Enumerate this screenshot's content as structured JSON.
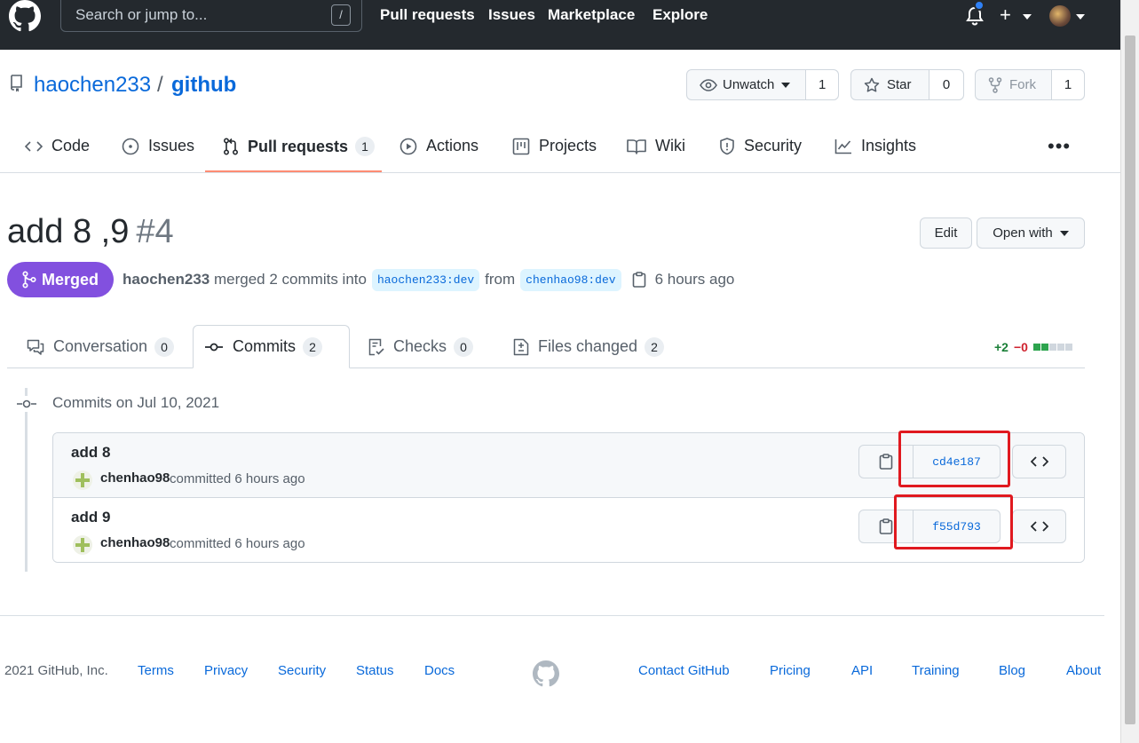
{
  "topbar": {
    "search_placeholder": "Search or jump to...",
    "search_shortcut": "/",
    "nav": [
      "Pull requests",
      "Issues",
      "Marketplace",
      "Explore"
    ],
    "plus": "+"
  },
  "repo": {
    "owner": "haochen233",
    "separator": "/",
    "name": "github",
    "unwatch": {
      "label": "Unwatch",
      "count": "1"
    },
    "star": {
      "label": "Star",
      "count": "0"
    },
    "fork": {
      "label": "Fork",
      "count": "1"
    }
  },
  "repo_nav": {
    "code": "Code",
    "issues": "Issues",
    "pull_requests": "Pull requests",
    "pull_requests_count": "1",
    "actions": "Actions",
    "projects": "Projects",
    "wiki": "Wiki",
    "security": "Security",
    "insights": "Insights",
    "more": "•••"
  },
  "pr": {
    "title": "add 8 ,9",
    "number": "#4",
    "edit": "Edit",
    "open_with": "Open with",
    "state": "Merged",
    "author": "haochen233",
    "merged_text": "merged 2 commits into",
    "base_branch": "haochen233:dev",
    "from_text": "from",
    "head_branch": "chenhao98:dev",
    "time": "6 hours ago"
  },
  "tabs": [
    {
      "label": "Conversation",
      "count": "0"
    },
    {
      "label": "Commits",
      "count": "2"
    },
    {
      "label": "Checks",
      "count": "0"
    },
    {
      "label": "Files changed",
      "count": "2"
    }
  ],
  "diffstat": {
    "additions": "+2",
    "deletions": "−0"
  },
  "commits": {
    "date_heading": "Commits on Jul 10, 2021",
    "items": [
      {
        "title": "add 8",
        "author": "chenhao98",
        "meta": "committed 6 hours ago",
        "sha": "cd4e187"
      },
      {
        "title": "add 9",
        "author": "chenhao98",
        "meta": "committed 6 hours ago",
        "sha": "f55d793"
      }
    ]
  },
  "footer": {
    "copyright": "2021 GitHub, Inc.",
    "links": [
      "Terms",
      "Privacy",
      "Security",
      "Status",
      "Docs",
      "Contact GitHub",
      "Pricing",
      "API",
      "Training",
      "Blog",
      "About"
    ]
  },
  "colors": {
    "topbar": "#24292e",
    "link": "#0969da",
    "merged": "#8250df",
    "highlight": "#e0191f"
  }
}
